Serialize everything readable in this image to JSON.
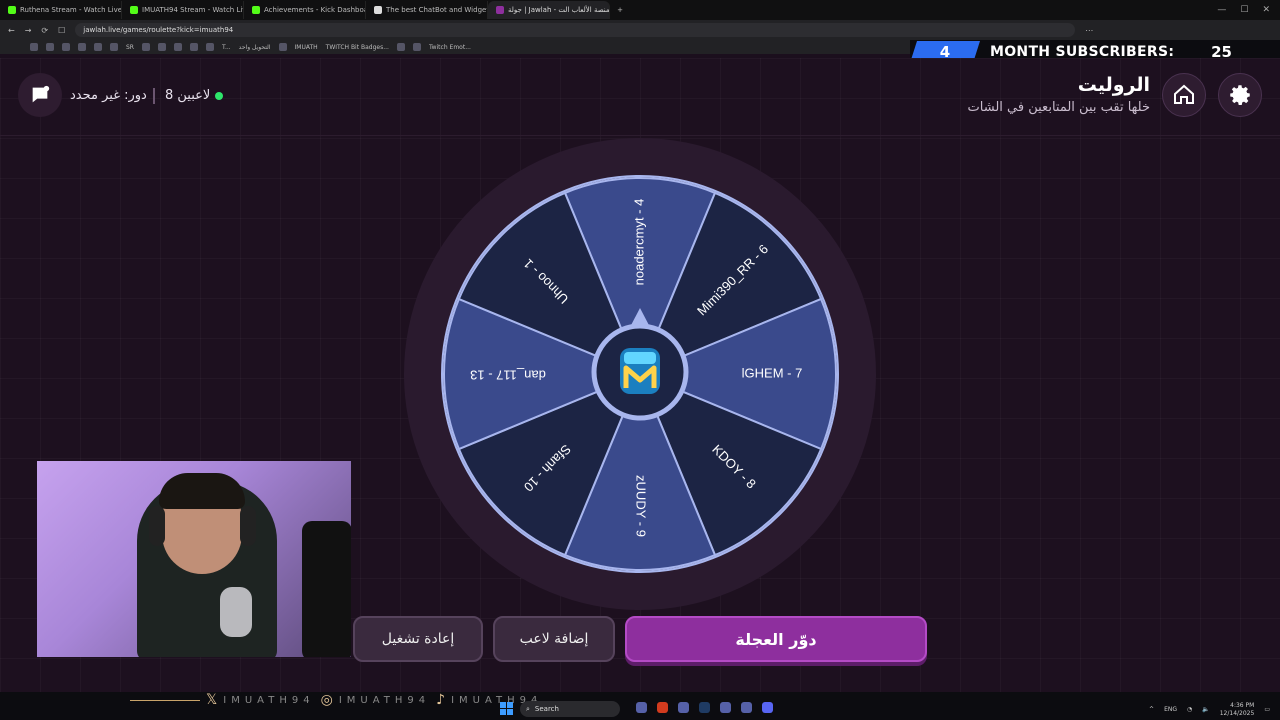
{
  "browser": {
    "tabs": [
      {
        "label": "Ruthena Stream - Watch Live o"
      },
      {
        "label": "IMUATH94 Stream - Watch Live o"
      },
      {
        "label": "Achievements - Kick Dashboard"
      },
      {
        "label": "The best ChatBot and Widgets for K"
      },
      {
        "label": "جولة | Jawlah - منصة الألعاب الت",
        "active": true
      }
    ],
    "url": "jawlah.live/games/roulette?kick=imuath94",
    "bookmarks": [
      "SR",
      "T...",
      "التحويل واحد",
      "IMUATH",
      "TWITCH Bit Badges...",
      "Twitch Emot..."
    ]
  },
  "overlay": {
    "subs_count": "4",
    "subs_label": "MONTH SUBSCRIBERS:",
    "subs_goal": "25"
  },
  "header": {
    "title": "الروليت",
    "subtitle": "خلها تقب بين المتابعين في الشات",
    "role_text": "دور: غير محدد",
    "players_text": "8 لاعبين"
  },
  "wheel": {
    "segments": [
      {
        "label": "noadercmyt - 4",
        "color": "#3a4a8c"
      },
      {
        "label": "Mimi390_RR - 6",
        "color": "#1c2444"
      },
      {
        "label": "lGHEM - 7",
        "color": "#3a4a8c"
      },
      {
        "label": "KDOY - 8",
        "color": "#1c2444"
      },
      {
        "label": "zUUDY - 9",
        "color": "#3a4a8c"
      },
      {
        "label": "Sfanh - 10",
        "color": "#1c2444"
      },
      {
        "label": "dan_117 - 13",
        "color": "#3a4a8c"
      },
      {
        "label": "Uhnoo - 1",
        "color": "#1c2444"
      }
    ],
    "rim_color": "#2a1a2e",
    "border_color": "#a8b6ee"
  },
  "buttons": {
    "spin": "دوّر العجلة",
    "add_player": "إضافة لاعب",
    "restart": "إعادة تشغيل"
  },
  "stream": {
    "handle": "IMUATH94"
  },
  "taskbar": {
    "search": "Search",
    "lang": "ENG",
    "time": "4:36 PM",
    "date": "12/14/2025"
  }
}
